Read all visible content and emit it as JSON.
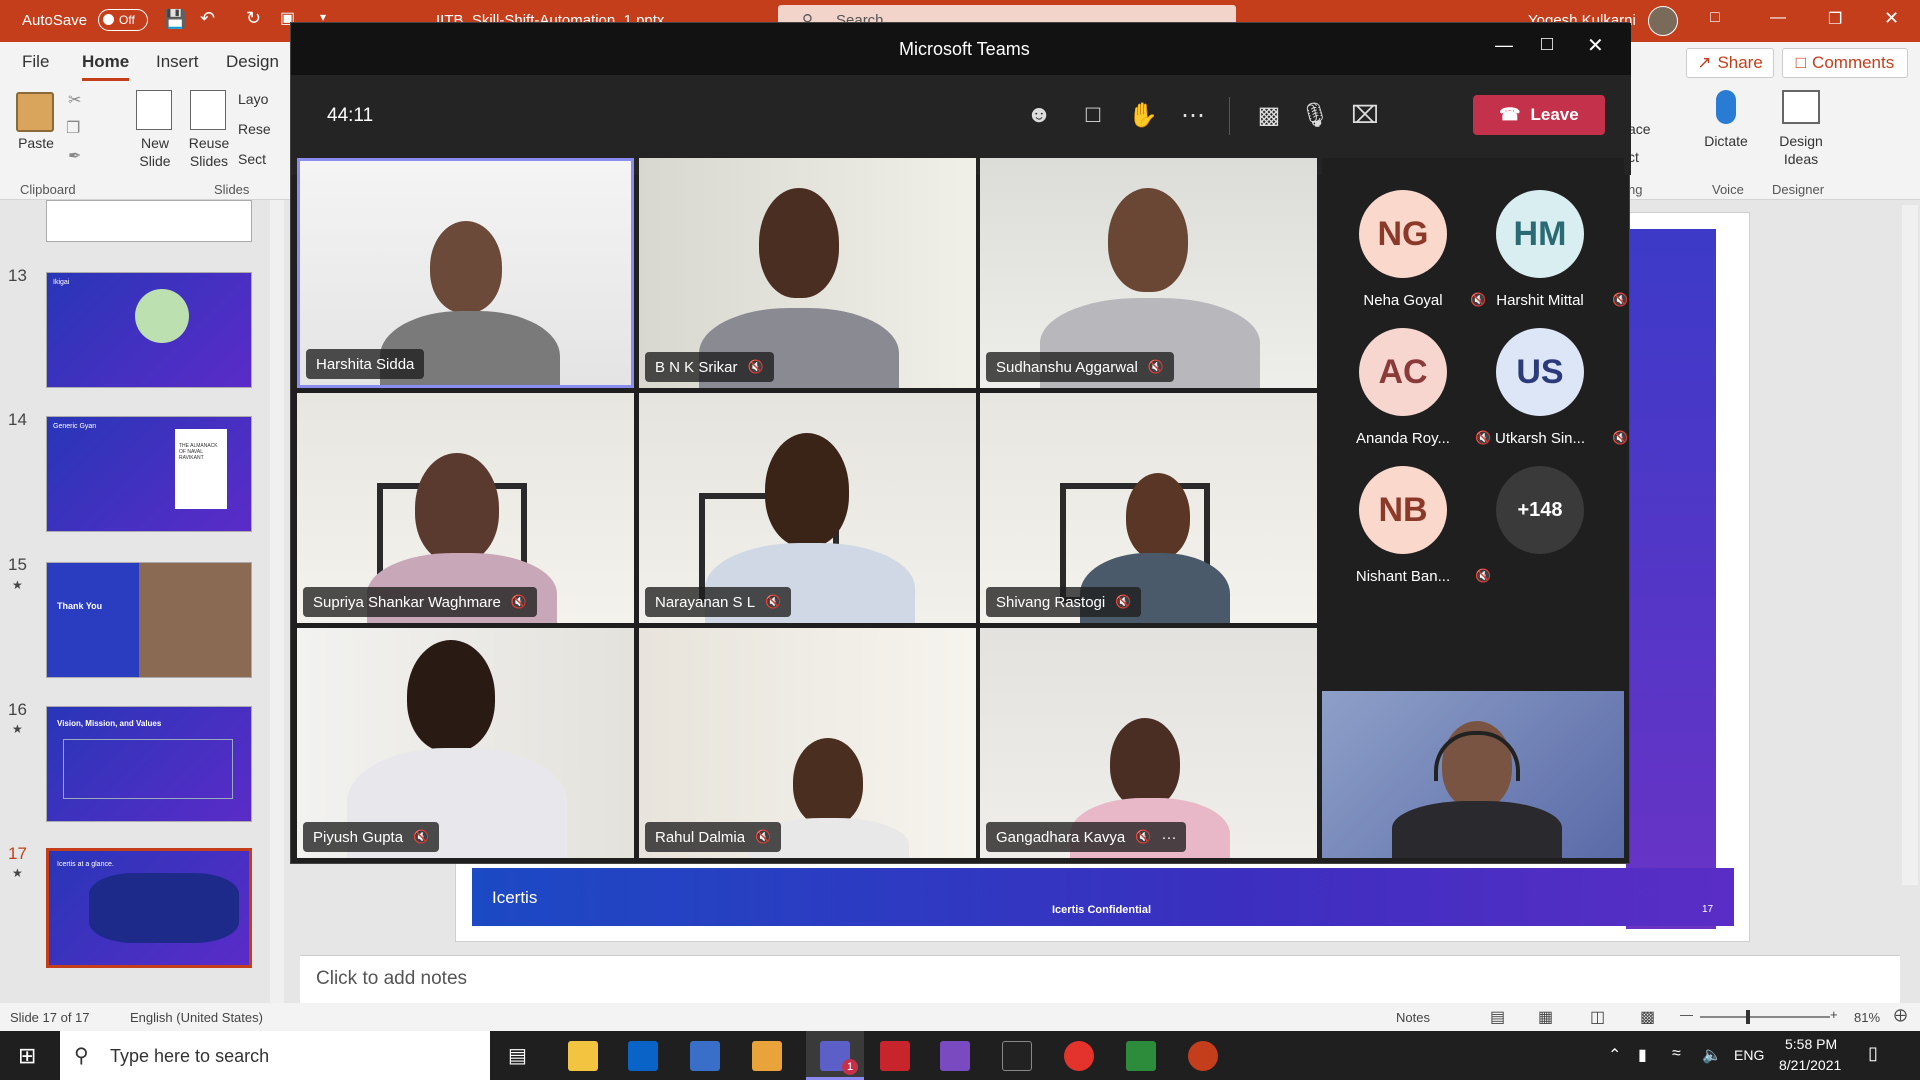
{
  "ppt": {
    "autosave_label": "AutoSave",
    "autosave_state": "Off",
    "file_name": "IITB_Skill-Shift-Automation_1.pptx",
    "search_placeholder": "Search",
    "user_name": "Yogesh Kulkarni",
    "tabs": [
      "File",
      "Home",
      "Insert",
      "Design"
    ],
    "share_label": "Share",
    "comments_label": "Comments",
    "ribbon": {
      "paste": "Paste",
      "new_slide": "New Slide",
      "reuse_slides": "Reuse Slides",
      "layout": "Layo",
      "reset": "Rese",
      "section": "Sect",
      "clipboard_group": "Clipboard",
      "slides_group": "Slides",
      "replace": "ace",
      "select": "ct",
      "editing_group": "ng",
      "dictate": "Dictate",
      "voice_group": "Voice",
      "design_ideas": "Design Ideas",
      "designer_group": "Designer"
    },
    "slide_numbers": [
      "13",
      "14",
      "15",
      "16",
      "17"
    ],
    "thumb_texts": {
      "t13": "Ikigai",
      "t14": "Generic Gyan",
      "t14_book": "THE ALMANACK OF NAVAL RAVIKANT",
      "t15": "Thank You",
      "t16": "Vision, Mission, and Values",
      "t17": "Icertis at a glance."
    },
    "slide_footer_logo": "Icertis",
    "slide_footer_conf": "Icertis Confidential",
    "slide_footer_num": "17",
    "notes_placeholder": "Click to add notes",
    "status_slide": "Slide 17 of 17",
    "status_lang": "English (United States)",
    "status_notes": "Notes",
    "zoom": "81%"
  },
  "teams": {
    "window_title": "Microsoft Teams",
    "timer": "44:11",
    "leave_label": "Leave",
    "participants": [
      {
        "name": "Harshita Sidda",
        "muted": false,
        "active": true
      },
      {
        "name": "B N K Srikar",
        "muted": true
      },
      {
        "name": "Sudhanshu Aggarwal",
        "muted": true
      },
      {
        "name": "Supriya Shankar Waghmare",
        "muted": true
      },
      {
        "name": "Narayanan S L",
        "muted": true
      },
      {
        "name": "Shivang Rastogi",
        "muted": true
      },
      {
        "name": "Piyush Gupta",
        "muted": true
      },
      {
        "name": "Rahul Dalmia",
        "muted": true
      },
      {
        "name": "Gangadhara Kavya",
        "muted": true,
        "more": "···"
      }
    ],
    "roster": [
      {
        "initials": "NG",
        "name": "Neha Goyal"
      },
      {
        "initials": "HM",
        "name": "Harshit Mittal"
      },
      {
        "initials": "AC",
        "name": "Ananda Roy..."
      },
      {
        "initials": "US",
        "name": "Utkarsh Sin..."
      },
      {
        "initials": "NB",
        "name": "Nishant Ban..."
      }
    ],
    "overflow_count": "+148"
  },
  "taskbar": {
    "search_placeholder": "Type here to search",
    "lang": "ENG",
    "time": "5:58 PM",
    "date": "8/21/2021",
    "teams_badge": "1"
  },
  "colors": {
    "ppt_accent": "#c43e1c",
    "teams_leave": "#c4314b",
    "teams_active_border": "#8b8cf0"
  }
}
